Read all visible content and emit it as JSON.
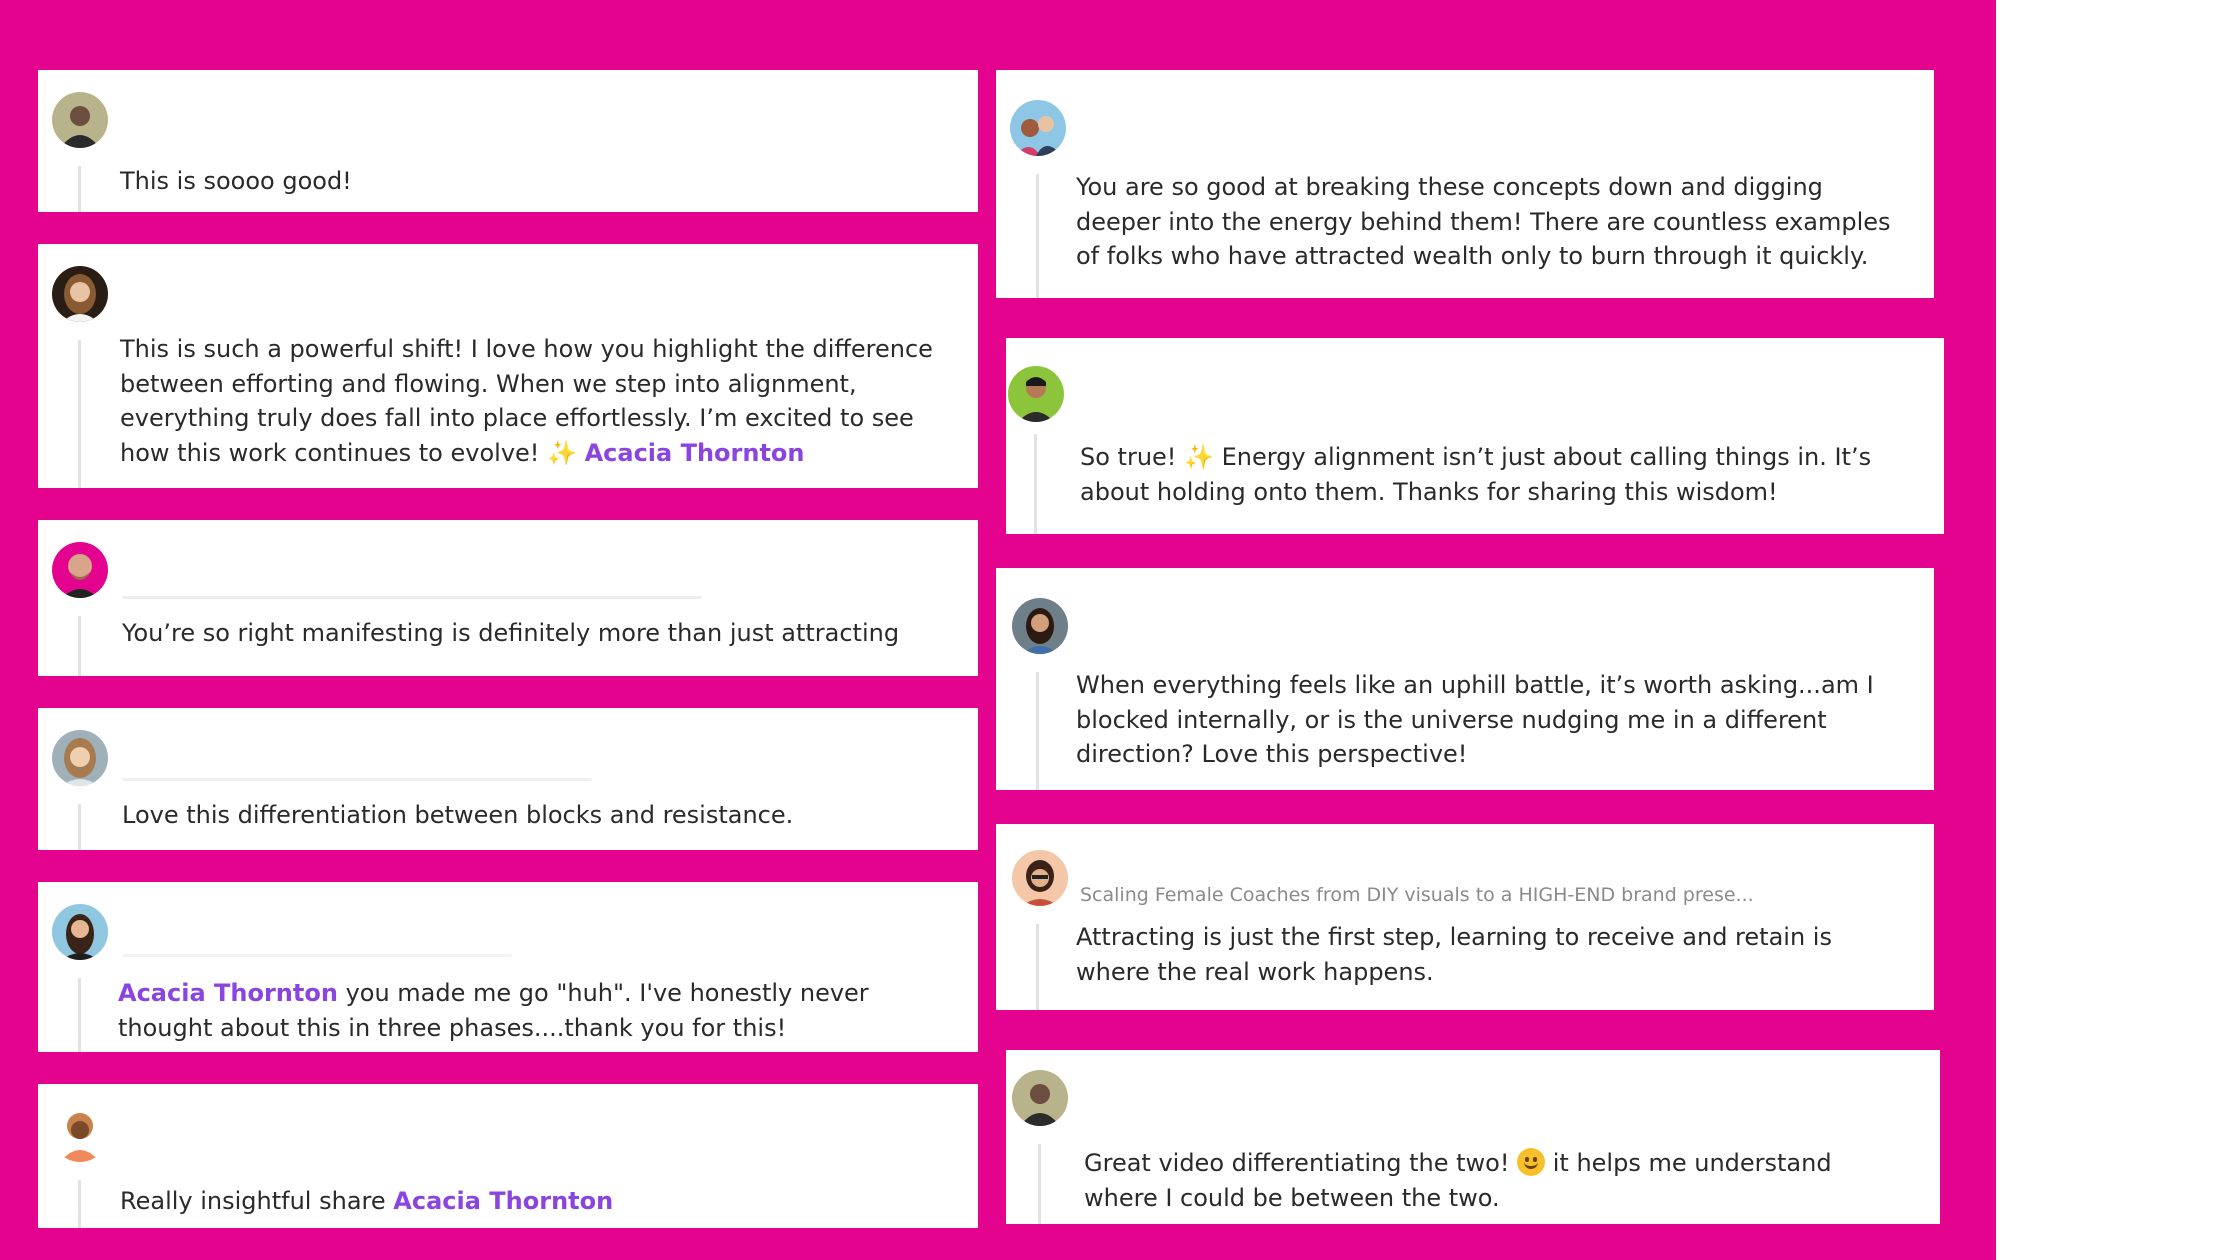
{
  "colors": {
    "background": "#e4038e",
    "card": "#ffffff",
    "mention": "#8a44e0"
  },
  "left_column": [
    {
      "id": "c1",
      "text": "This is soooo good!"
    },
    {
      "id": "c2",
      "text": "This is such a powerful shift! I love how you highlight the difference between efforting and flowing. When we step into alignment, everything truly does fall into place effortlessly. I’m excited to see how this work continues to evolve!",
      "sparkle": "✨",
      "mention": "Acacia Thornton"
    },
    {
      "id": "c3",
      "text": "You’re so right manifesting is definitely more than just attracting"
    },
    {
      "id": "c4",
      "text": "Love this differentiation between blocks and resistance."
    },
    {
      "id": "c5",
      "mention": "Acacia Thornton",
      "text": "you made me go \"huh\". I've honestly never thought about this in three phases....thank you for this!"
    },
    {
      "id": "c6",
      "text": "Really insightful share",
      "mention": "Acacia Thornton"
    }
  ],
  "right_column": [
    {
      "id": "c7",
      "text": "You are so good at breaking these concepts down and digging deeper into the energy behind them! There are countless examples of folks who have attracted wealth only to burn through it quickly."
    },
    {
      "id": "c8",
      "text_before": "So true!",
      "sparkle": "✨",
      "text_after": "Energy alignment isn’t just about calling things in. It’s about holding onto them. Thanks for sharing this wisdom!"
    },
    {
      "id": "c9",
      "text": "When everything feels like an uphill battle, it’s worth asking...am I blocked internally, or is the universe nudging me in a different direction? Love this perspective!"
    },
    {
      "id": "c10",
      "subtitle": "Scaling Female Coaches from DIY visuals to a HIGH-END brand prese...",
      "text": "Attracting is just the first step, learning to receive and retain is where the real work happens."
    },
    {
      "id": "c11",
      "text_before": "Great video differentiating the two!",
      "emoji": "smiling-face-emoji",
      "text_after": "it helps me understand where I could be between the two."
    }
  ]
}
